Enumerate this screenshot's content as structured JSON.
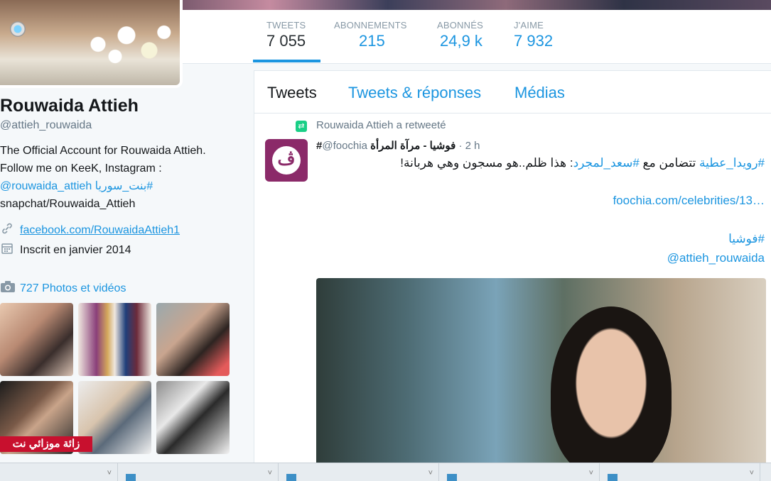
{
  "profile": {
    "name": "Rouwaida Attieh",
    "handle": "@attieh_rouwaida",
    "bio_line1": "The Official Account for Rouwaida Attieh.",
    "bio_line2": "Follow me on KeeK, Instagram :",
    "bio_mention": "@rouwaida_attieh",
    "bio_hashtag": "#بنت_سوريا",
    "bio_line4": "snapchat/Rouwaida_Attieh",
    "website": "facebook.com/RouwaidaAttieh1",
    "joined": "Inscrit en janvier 2014",
    "photos_label": "727 Photos et vidéos"
  },
  "stats": [
    {
      "label": "TWEETS",
      "value": "7 055"
    },
    {
      "label": "ABONNEMENTS",
      "value": "215"
    },
    {
      "label": "ABONNÉS",
      "value": "24,9 k"
    },
    {
      "label": "J'AIME",
      "value": "7 932"
    }
  ],
  "tabs": [
    "Tweets",
    "Tweets & réponses",
    "Médias"
  ],
  "tweet": {
    "retweet_line": "Rouwaida Attieh a retweeté",
    "author_name": "فوشيا - مرآة المرأة",
    "author_prefix": "#",
    "author_handle": "@foochia",
    "time": "· 2 h",
    "text_hashtag1": "#رويدا_عطية",
    "text_mid": " تتضامن مع ",
    "text_hashtag2": "#سعد_لمجرد",
    "text_end": ": هذا ظلم..هو مسجون وهي هربانة!",
    "link": "foochia.com/celebrities/13…",
    "hashtag3": "#فوشيا",
    "mention": "@attieh_rouwaida"
  },
  "watermark": "زائة موزائي نت",
  "colors": {
    "accent": "#1b95e0",
    "retweet": "#19cf86",
    "avatar_bg": "#8b2a69"
  }
}
